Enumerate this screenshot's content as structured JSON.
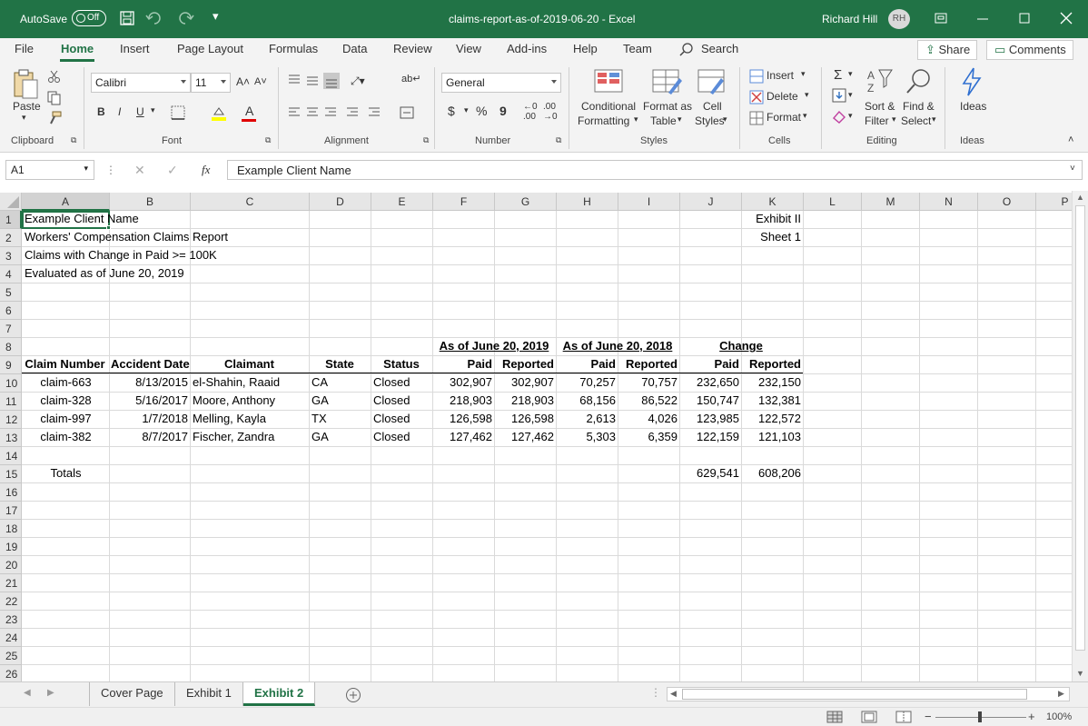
{
  "titlebar": {
    "autosave_label": "AutoSave",
    "autosave_state": "Off",
    "title": "claims-report-as-of-2019-06-20 - Excel",
    "user_name": "Richard Hill",
    "user_initials": "RH"
  },
  "menu": {
    "items": [
      "File",
      "Home",
      "Insert",
      "Page Layout",
      "Formulas",
      "Data",
      "Review",
      "View",
      "Add-ins",
      "Help",
      "Team"
    ],
    "search": "Search",
    "share": "Share",
    "comments": "Comments"
  },
  "ribbon": {
    "clipboard": {
      "paste": "Paste",
      "label": "Clipboard"
    },
    "font": {
      "name": "Calibri",
      "size": "11",
      "bold": "B",
      "italic": "I",
      "underline": "U",
      "label": "Font"
    },
    "alignment": {
      "label": "Alignment"
    },
    "number": {
      "format": "General",
      "currency": "$",
      "percent": "%",
      "comma": "9",
      "label": "Number"
    },
    "styles": {
      "cond1": "Conditional",
      "cond2": "Formatting",
      "fmt1": "Format as",
      "fmt2": "Table",
      "cell1": "Cell",
      "cell2": "Styles",
      "label": "Styles"
    },
    "cells": {
      "insert": "Insert",
      "delete": "Delete",
      "format": "Format",
      "label": "Cells"
    },
    "editing": {
      "sort1": "Sort &",
      "sort2": "Filter",
      "find1": "Find &",
      "find2": "Select",
      "label": "Editing"
    },
    "ideas": {
      "button": "Ideas",
      "label": "Ideas"
    }
  },
  "formula_bar": {
    "namebox": "A1",
    "fx": "fx",
    "value": "Example Client Name"
  },
  "columns": [
    "A",
    "B",
    "C",
    "D",
    "E",
    "F",
    "G",
    "H",
    "I",
    "J",
    "K",
    "L",
    "M",
    "N",
    "O",
    "P"
  ],
  "rows": [
    "1",
    "2",
    "3",
    "4",
    "5",
    "6",
    "7",
    "8",
    "9",
    "10",
    "11",
    "12",
    "13",
    "14",
    "15",
    "16",
    "17",
    "18",
    "19",
    "20",
    "21",
    "22",
    "23",
    "24",
    "25",
    "26"
  ],
  "sheet": {
    "header": {
      "client": "Example Client Name",
      "report": "Workers' Compensation Claims Report",
      "criteria": "Claims with Change in Paid >= 100K",
      "evaluated": "Evaluated as of June 20, 2019",
      "exhibit": "Exhibit II",
      "sheet_no": "Sheet 1"
    },
    "group_headers": {
      "asof2019": "As of June 20, 2019",
      "asof2018": "As of June 20, 2018",
      "change": "Change"
    },
    "col_headers": [
      "Claim Number",
      "Accident Date",
      "Claimant",
      "State",
      "Status",
      "Paid",
      "Reported",
      "Paid",
      "Reported",
      "Paid",
      "Reported"
    ],
    "data_rows": [
      [
        "claim-663",
        "8/13/2015",
        "el-Shahin, Raaid",
        "CA",
        "Closed",
        "302,907",
        "302,907",
        "70,257",
        "70,757",
        "232,650",
        "232,150"
      ],
      [
        "claim-328",
        "5/16/2017",
        "Moore, Anthony",
        "GA",
        "Closed",
        "218,903",
        "218,903",
        "68,156",
        "86,522",
        "150,747",
        "132,381"
      ],
      [
        "claim-997",
        "1/7/2018",
        "Melling, Kayla",
        "TX",
        "Closed",
        "126,598",
        "126,598",
        "2,613",
        "4,026",
        "123,985",
        "122,572"
      ],
      [
        "claim-382",
        "8/7/2017",
        "Fischer, Zandra",
        "GA",
        "Closed",
        "127,462",
        "127,462",
        "5,303",
        "6,359",
        "122,159",
        "121,103"
      ]
    ],
    "totals": {
      "label": "Totals",
      "change_paid": "629,541",
      "change_reported": "608,206"
    }
  },
  "tabs": [
    "Cover Page",
    "Exhibit 1",
    "Exhibit 2"
  ],
  "status": {
    "zoom": "100%"
  },
  "colors": {
    "accent": "#217346"
  }
}
